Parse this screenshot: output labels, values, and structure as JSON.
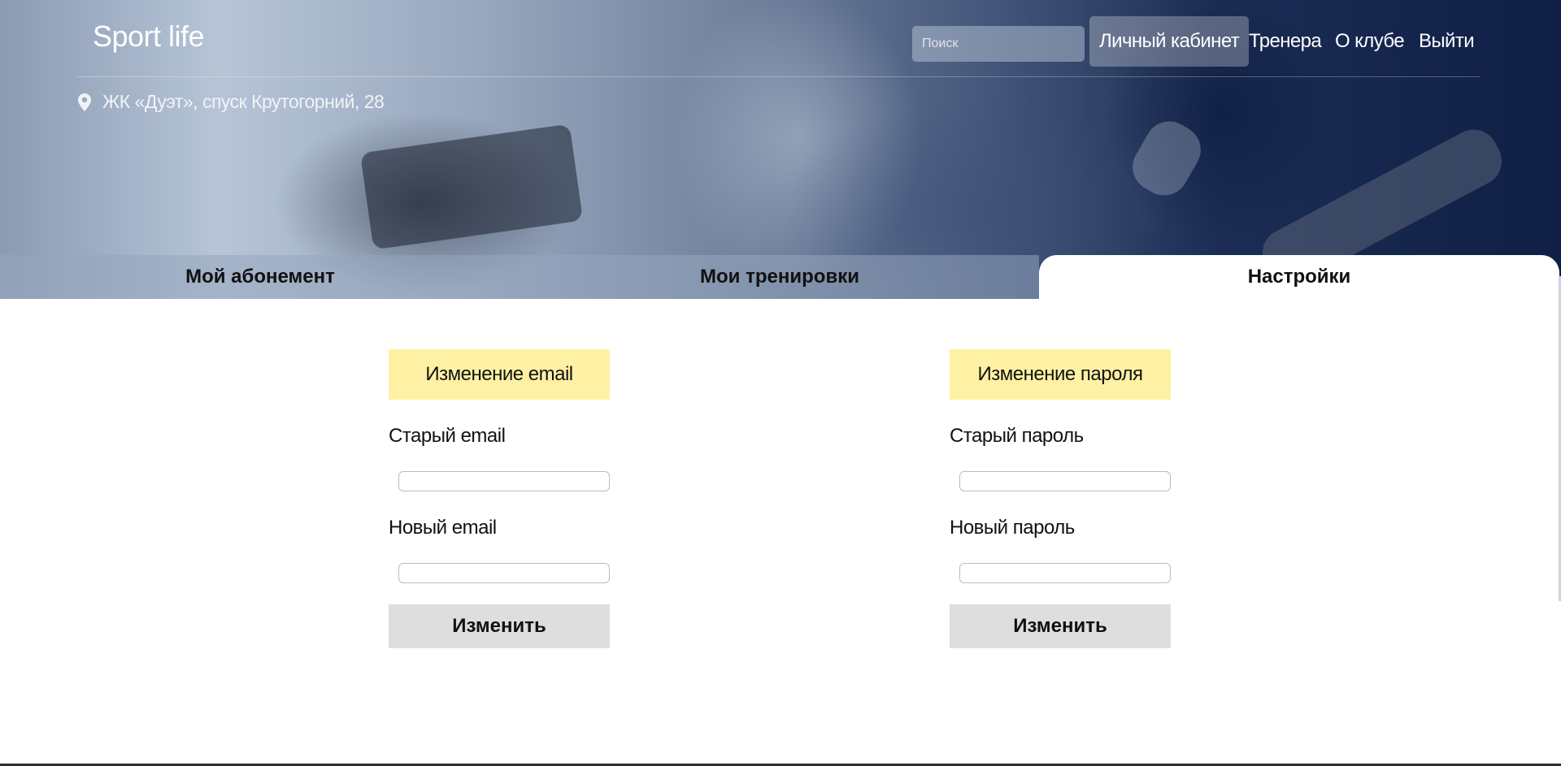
{
  "header": {
    "logo": "Sport life",
    "search_placeholder": "Поиск",
    "nav": {
      "cabinet": "Личный кабинет",
      "trainers": "Тренера",
      "about": "О клубе",
      "logout": "Выйти"
    },
    "address": "ЖК «Дуэт», спуск Крутогорний, 28"
  },
  "tabs": {
    "subscription": "Мой абонемент",
    "workouts": "Мои тренировки",
    "settings": "Настройки"
  },
  "email_form": {
    "title": "Изменение email",
    "old_label": "Старый email",
    "new_label": "Новый email",
    "old_value": "",
    "new_value": "",
    "submit": "Изменить"
  },
  "password_form": {
    "title": "Изменение пароля",
    "old_label": "Старый пароль",
    "new_label": "Новый пароль",
    "old_value": "",
    "new_value": "",
    "submit": "Изменить"
  },
  "colors": {
    "form_header_bg": "#fff1a3",
    "button_bg": "#dedede",
    "hero_dark": "#0f1f45"
  },
  "icons": {
    "address": "map-pin-icon"
  }
}
